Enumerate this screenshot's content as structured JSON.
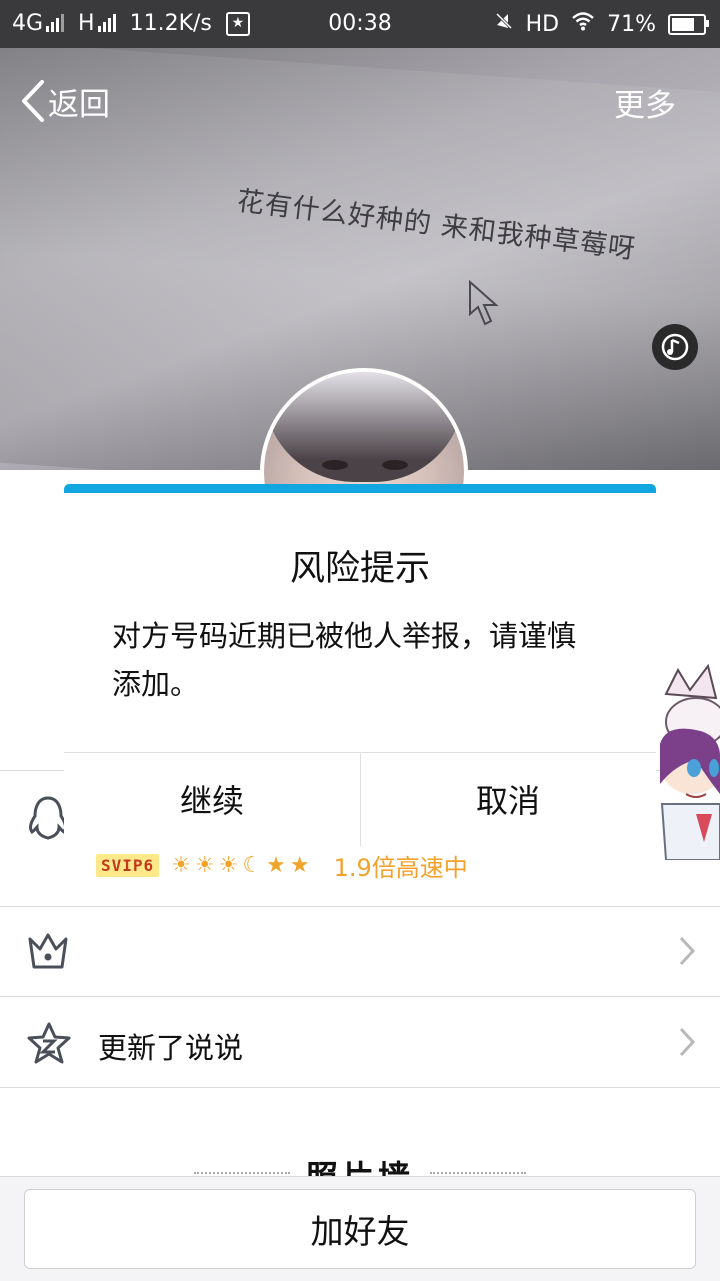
{
  "status_bar": {
    "network_1": "4G",
    "network_2": "H",
    "speed": "11.2K/s",
    "time": "00:38",
    "hd": "HD",
    "battery": "71%"
  },
  "cover": {
    "back_label": "返回",
    "more_label": "更多",
    "photo_caption": "花有什么好种的 来和我种草莓呀"
  },
  "dialog": {
    "title": "风险提示",
    "message": "对方号码近期已被他人举报，请谨慎添加。",
    "continue_label": "继续",
    "cancel_label": "取消"
  },
  "profile": {
    "vip_badge": "SVIP6",
    "level_icons": [
      "sun",
      "sun",
      "sun",
      "moon",
      "star",
      "star"
    ],
    "speed_text": "1.9倍高速中",
    "status_row_text": "更新了说说",
    "photo_wall_label": "照片墙"
  },
  "bottom": {
    "add_friend_label": "加好友"
  },
  "colors": {
    "accent": "#12a6e1",
    "vip_gold": "#f2a22c"
  }
}
